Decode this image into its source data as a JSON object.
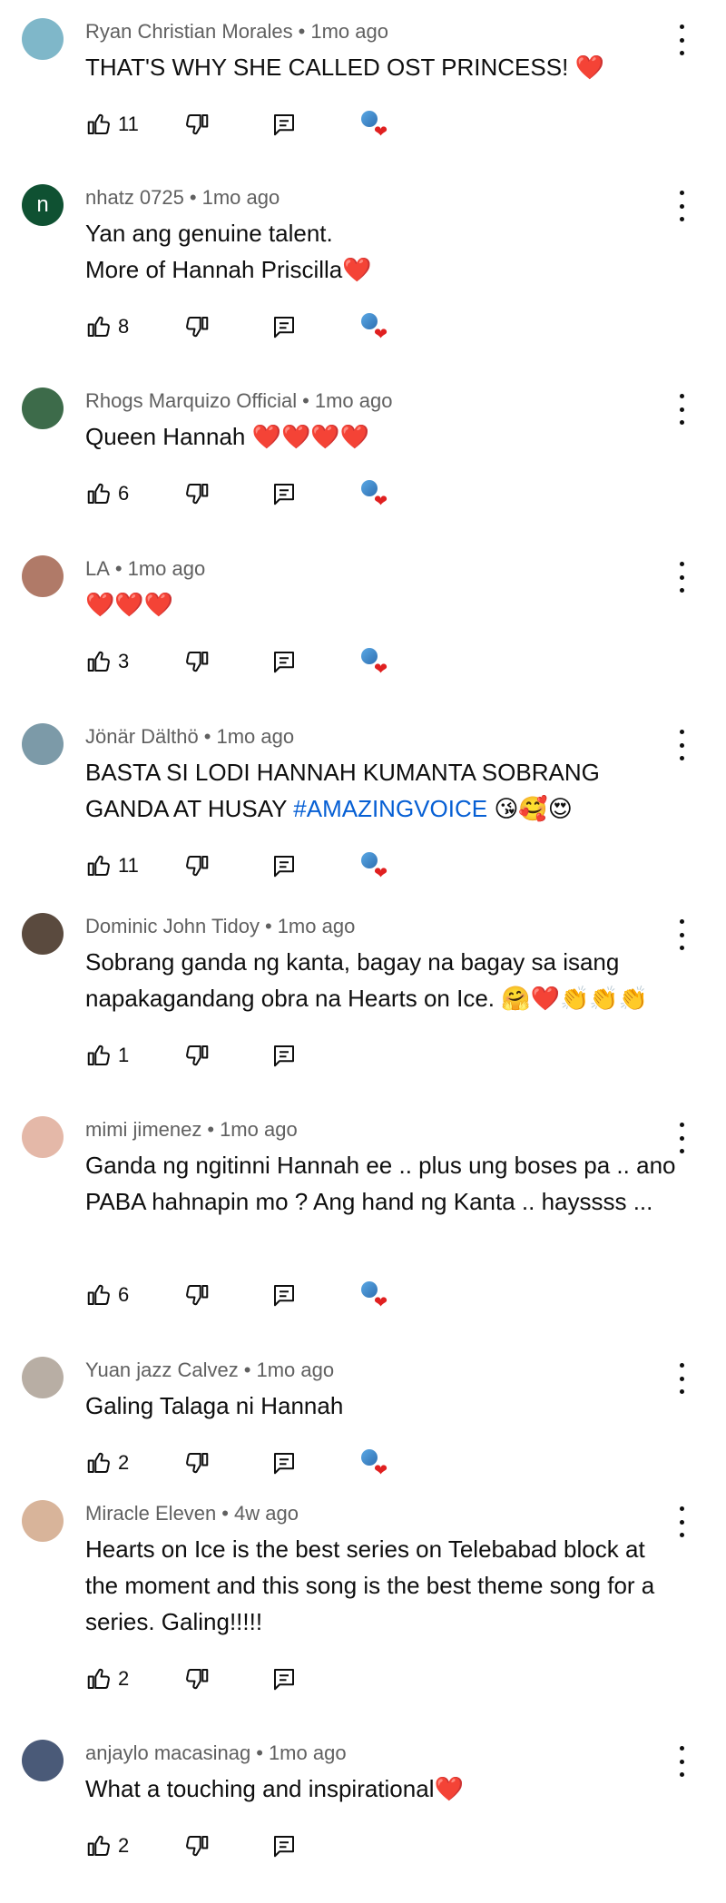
{
  "comments": [
    {
      "author": "Ryan Christian Morales",
      "time": "1mo ago",
      "text": "THAT'S WHY SHE CALLED OST PRINCESS! ❤️",
      "likes": "11",
      "creator_heart": true,
      "avatar": "avatar-photo",
      "avatar_color": "#7fb7c9"
    },
    {
      "author": "nhatz 0725",
      "time": "1mo ago",
      "text": "Yan ang genuine talent.\nMore of Hannah Priscilla❤️",
      "likes": "8",
      "creator_heart": true,
      "avatar": "n",
      "avatar_color": "#0f5132"
    },
    {
      "author": "Rhogs Marquizo Official",
      "time": "1mo ago",
      "text": "Queen Hannah ❤️❤️❤️❤️",
      "likes": "6",
      "creator_heart": true,
      "avatar": "avatar-photo",
      "avatar_color": "#3d6b4a"
    },
    {
      "author": "LA",
      "time": "1mo ago",
      "text": "❤️❤️❤️",
      "likes": "3",
      "creator_heart": true,
      "avatar": "avatar-photo",
      "avatar_color": "#b07a68"
    },
    {
      "author": "Jönär Dälthö",
      "time": "1mo ago",
      "text": "BASTA SI LODI HANNAH KUMANTA SOBRANG GANDA AT HUSAY ",
      "hashtag": "#AMAZINGVOICE",
      "text_after": " 😘🥰😍",
      "likes": "11",
      "creator_heart": true,
      "avatar": "avatar-photo",
      "avatar_color": "#7c9aa8"
    },
    {
      "author": "Dominic John Tidoy",
      "time": "1mo ago",
      "text": "Sobrang ganda ng kanta, bagay na bagay sa isang napakagandang obra na Hearts on Ice. 🤗❤️👏👏👏",
      "likes": "1",
      "creator_heart": false,
      "avatar": "avatar-photo",
      "avatar_color": "#5a4a3e"
    },
    {
      "author": "mimi jimenez",
      "time": "1mo ago",
      "text": "Ganda ng ngitinni Hannah ee .. plus ung boses pa .. ano PABA hahnapin mo ? Ang hand ng Kanta .. hayssss ...",
      "likes": "6",
      "creator_heart": true,
      "avatar": "avatar-photo",
      "avatar_color": "#e4b8a8"
    },
    {
      "author": "Yuan jazz Calvez",
      "time": "1mo ago",
      "text": "Galing Talaga ni Hannah",
      "likes": "2",
      "creator_heart": true,
      "avatar": "avatar-photo",
      "avatar_color": "#b8aea4"
    },
    {
      "author": "Miracle Eleven",
      "time": "4w ago",
      "text": "Hearts on Ice is the best series on Telebabad block at the moment and this song is the best theme song for a series. Galing!!!!!",
      "likes": "2",
      "creator_heart": false,
      "avatar": "avatar-photo",
      "avatar_color": "#d8b49a"
    },
    {
      "author": "anjaylo macasinag",
      "time": "1mo ago",
      "text": "What a touching and inspirational❤️",
      "likes": "2",
      "creator_heart": false,
      "avatar": "avatar-photo",
      "avatar_color": "#4a5a78"
    }
  ],
  "colors": {
    "text": "#0f0f0f",
    "meta": "#606060",
    "hashtag": "#065fd4",
    "heart": "#e02020"
  },
  "icons": {
    "like": "thumbs-up-icon",
    "dislike": "thumbs-down-icon",
    "reply": "reply-icon",
    "menu": "more-vert-icon",
    "creator_heart": "creator-heart-icon"
  }
}
